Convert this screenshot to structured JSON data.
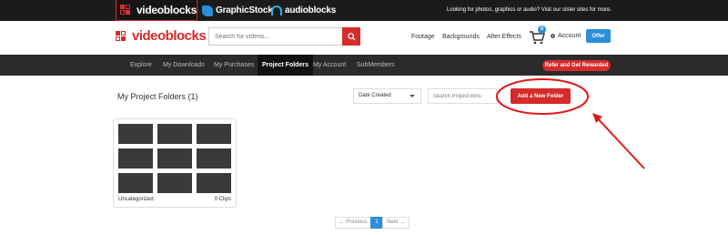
{
  "sister_bar": {
    "videoblocks": "videoblocks",
    "graphicstock": "GraphicStock",
    "audioblocks": "audioblocks",
    "tagline": "Looking for photos, graphics or audio? Visit our sister sites for more."
  },
  "header": {
    "logo": "videoblocks",
    "search_placeholder": "Search for videos...",
    "nav": [
      "Footage",
      "Backgrounds",
      "After Effects"
    ],
    "cart_count": "0",
    "account": "Account",
    "offer": "Offer"
  },
  "navbar": {
    "items": [
      "Explore",
      "My Downloads",
      "My Purchases",
      "Project Folders",
      "My Account",
      "SubMembers"
    ],
    "active": "Project Folders",
    "refer": "Refer and Get Rewarded"
  },
  "content": {
    "title": "My Project Folders (1)",
    "sort_value": "Date Created",
    "bins_placeholder": "Search Project Bins",
    "add_folder": "Add a New Folder",
    "folders": [
      {
        "name": "Uncategorized",
        "clips": "0 Clips"
      }
    ]
  },
  "pager": {
    "prev": "← Previous",
    "page": "1",
    "next": "Next →"
  },
  "colors": {
    "brand_red": "#d52b2b",
    "brand_blue": "#2b8ed8",
    "nav_dark": "#2b2b2b"
  }
}
